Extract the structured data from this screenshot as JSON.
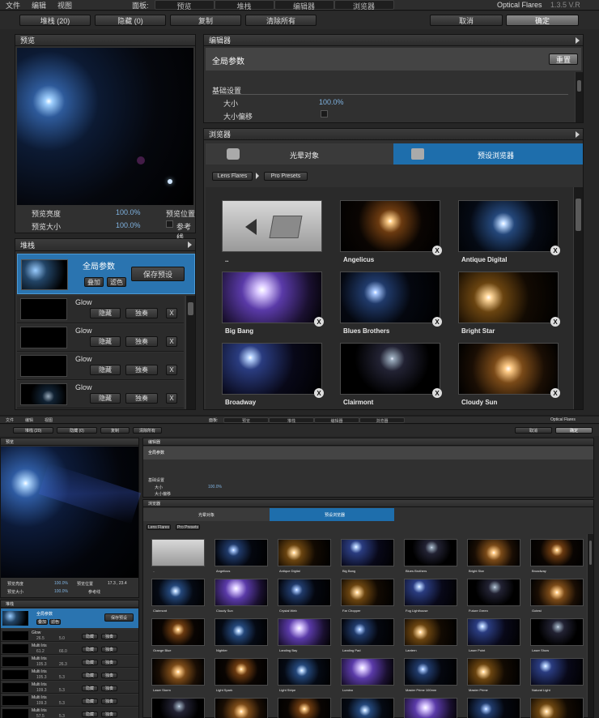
{
  "top": {
    "menu": [
      "文件",
      "编辑",
      "视图"
    ],
    "panel_label": "面板:",
    "panel_tabs": [
      "预览",
      "堆栈",
      "编辑器",
      "浏览器"
    ],
    "app_title": "Optical Flares",
    "version": "1.3.5 V.R",
    "buttons": {
      "stack_count": "堆栈 (20)",
      "hidden_count": "隐藏 (0)",
      "copy": "复制",
      "clear_all": "清除所有",
      "cancel": "取消",
      "ok": "确定"
    },
    "preview": {
      "title": "预览",
      "brightness_label": "预览亮度",
      "brightness_val": "100.0%",
      "size_label": "预览大小",
      "size_val": "100.0%",
      "position_label": "预览位置",
      "guides_label": "参考线"
    },
    "stack": {
      "title": "堆栈",
      "global_title": "全局参数",
      "add": "叠加",
      "filter": "滤色",
      "save_preset": "保存预设",
      "items": [
        {
          "name": "Glow",
          "hide": "隐藏",
          "solo": "独奏"
        },
        {
          "name": "Glow",
          "hide": "隐藏",
          "solo": "独奏"
        },
        {
          "name": "Glow",
          "hide": "隐藏",
          "solo": "独奏"
        },
        {
          "name": "Glow",
          "hide": "隐藏",
          "solo": "独奏"
        }
      ]
    },
    "editor": {
      "title": "编辑器",
      "global_title": "全局参数",
      "reset": "重置",
      "basic": "基础设置",
      "size_label": "大小",
      "size_val": "100.0%",
      "size_offset_label": "大小偏移"
    },
    "browser": {
      "title": "浏览器",
      "tab_lens": "光晕对象",
      "tab_preset": "预设浏览器",
      "crumb1": "Lens Flares",
      "crumb2": "Pro Presets",
      "thumbs": [
        "..",
        "Angelicus",
        "Antique Digital",
        "Big Bang",
        "Blues Brothers",
        "Bright Star",
        "Broadway",
        "Clairmont",
        "Cloudy Sun"
      ]
    },
    "x": "X"
  },
  "bottom": {
    "menu": [
      "文件",
      "编辑",
      "视图"
    ],
    "panel_label": "面板:",
    "panel_tabs": [
      "预览",
      "堆栈",
      "编辑器",
      "浏览器"
    ],
    "app_title": "Optical Flares",
    "buttons": {
      "stack_count": "堆栈 (20)",
      "hidden_count": "隐藏 (0)",
      "copy": "复制",
      "clear_all": "清除所有",
      "cancel": "取消",
      "ok": "确定"
    },
    "preview": {
      "title": "预览",
      "brightness_label": "预览亮度",
      "brightness_val": "100.0%",
      "size_label": "预览大小",
      "size_val": "100.0%",
      "position_label": "预览位置",
      "position_val": "17.3 , 23.4",
      "guides_label": "参考线"
    },
    "stack": {
      "title": "堆栈",
      "global_title": "全局参数",
      "add": "叠加",
      "filter": "滤色",
      "save_preset": "保存预设",
      "items": [
        {
          "name": "Glow",
          "a": "26.5",
          "b": "5.0"
        },
        {
          "name": "Multi Iris",
          "a": "61.2",
          "b": "66.0"
        },
        {
          "name": "Multi Iris",
          "a": "105.3",
          "b": "26.3"
        },
        {
          "name": "Multi Iris",
          "a": "105.3",
          "b": "5.3"
        },
        {
          "name": "Multi Iris",
          "a": "109.3",
          "b": "5.3"
        },
        {
          "name": "Multi Iris",
          "a": "109.3",
          "b": "5.3"
        },
        {
          "name": "Multi Iris",
          "a": "57.5",
          "b": "5.3"
        }
      ],
      "hide": "隐藏",
      "solo": "独奏"
    },
    "editor": {
      "title": "编辑器",
      "global_title": "全局参数",
      "basic": "基础设置",
      "size_label": "大小",
      "size_val": "100.0%",
      "size_offset_label": "大小偏移"
    },
    "browser": {
      "title": "浏览器",
      "tab_lens": "光晕对象",
      "tab_preset": "预设浏览器",
      "crumb1": "Lens Flares",
      "crumb2": "Pro Presets",
      "thumbs": [
        "..",
        "Angelicus",
        "Antique Digital",
        "Big Bang",
        "Blues Brothers",
        "Bright Star",
        "Broadway",
        "Clairmont",
        "Cloudy Sun",
        "Crystal Web",
        "Far Chopper",
        "Fog Lighthouse",
        "Future Green",
        "Gotest",
        "Grange Blue",
        "Nightier",
        "Landing Bay",
        "Landing Pad",
        "Lantern",
        "Laser Point",
        "Laser Show",
        "Laser Storm",
        "Light Spark",
        "Light Stripe",
        "Lumino",
        "Master Prime 100mm",
        "Master Prime",
        "Natural Light",
        "",
        "",
        "",
        "",
        "",
        "",
        ""
      ]
    }
  }
}
